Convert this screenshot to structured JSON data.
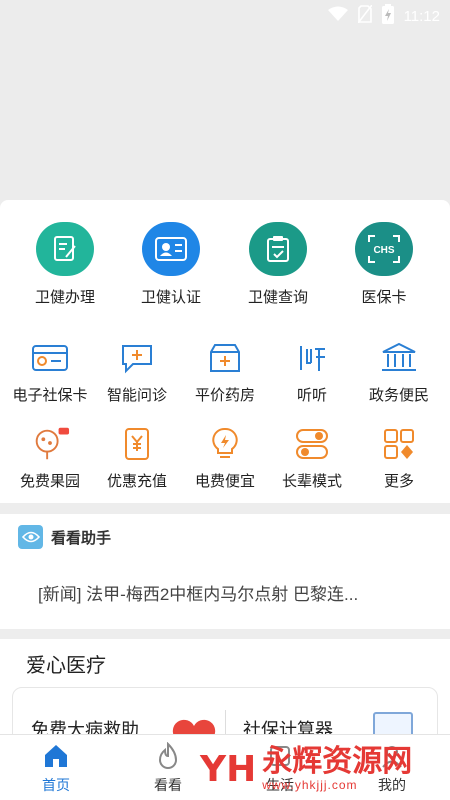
{
  "status_bar": {
    "time": "11:12"
  },
  "top_services": [
    {
      "label": "卫健办理",
      "icon": "document-edit-icon",
      "color": "#22b59b"
    },
    {
      "label": "卫健认证",
      "icon": "id-card-icon",
      "color": "#1f86e6"
    },
    {
      "label": "卫健查询",
      "icon": "clipboard-check-icon",
      "color": "#1b9a88"
    },
    {
      "label": "医保卡",
      "icon": "chs-scan-icon",
      "color": "#1b8f87",
      "icon_text": "CHS"
    }
  ],
  "grid_row1": [
    {
      "label": "电子社保卡",
      "icon": "social-card-icon"
    },
    {
      "label": "智能问诊",
      "icon": "chat-plus-icon"
    },
    {
      "label": "平价药房",
      "icon": "pharmacy-icon"
    },
    {
      "label": "听听",
      "icon": "listen-icon"
    },
    {
      "label": "政务便民",
      "icon": "government-building-icon"
    }
  ],
  "grid_row2": [
    {
      "label": "免费果园",
      "icon": "fruit-tree-icon",
      "badge": ""
    },
    {
      "label": "优惠充值",
      "icon": "yuan-phone-icon"
    },
    {
      "label": "电费便宜",
      "icon": "lightbulb-bolt-icon"
    },
    {
      "label": "长辈模式",
      "icon": "toggle-switch-icon"
    },
    {
      "label": "更多",
      "icon": "grid-more-icon"
    }
  ],
  "assistant": {
    "title": "看看助手",
    "news": "[新闻]  法甲-梅西2中框内马尔点射 巴黎连..."
  },
  "medical": {
    "title": "爱心医疗",
    "card_left": "免费大病救助",
    "card_right": "社保计算器"
  },
  "tabbar": [
    {
      "label": "首页",
      "icon": "home-icon",
      "active": true
    },
    {
      "label": "看看",
      "icon": "flame-icon",
      "active": false
    },
    {
      "label": "生活",
      "icon": "life-icon",
      "active": false
    },
    {
      "label": "我的",
      "icon": "profile-icon",
      "active": false
    }
  ],
  "watermark": {
    "main": "永辉资源网",
    "sub": "www.yhkjjj.com"
  },
  "colors": {
    "accent": "#1f77d6",
    "icon_blue": "#2a7fd4",
    "icon_orange": "#f08a2c"
  }
}
